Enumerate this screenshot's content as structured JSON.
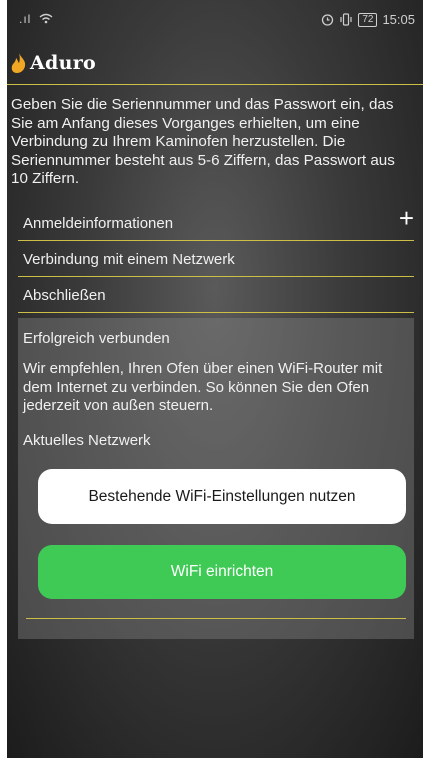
{
  "status_bar": {
    "signal": ".ıl",
    "wifi": "wifi-icon",
    "alarm": "alarm-icon",
    "vibrate": "vibrate-icon",
    "battery": "72",
    "time": "15:05"
  },
  "app": {
    "brand": "Aduro",
    "accent_color": "#cbbf47",
    "logo_color": "#f0a824"
  },
  "intro_text": "Geben Sie die Seriennummer und das Passwort ein, das Sie am Anfang dieses Vorganges erhielten, um eine Verbindung zu Ihrem Kaminofen herzustellen. Die Seriennummer besteht aus 5-6 Ziffern, das Passwort aus 10 Ziffern.",
  "steps": [
    {
      "label": "Anmeldeinformationen",
      "icon": "plus-icon",
      "icon_text": "+"
    },
    {
      "label": "Verbindung mit einem Netzwerk"
    },
    {
      "label": "Abschließen"
    }
  ],
  "panel": {
    "title": "Erfolgreich verbunden",
    "text": "Wir empfehlen, Ihren Ofen über einen WiFi-Router mit dem Internet zu verbinden. So können Sie den Ofen jederzeit von außen steuern.",
    "subtitle": "Aktuelles Netzwerk",
    "button_existing": "Bestehende WiFi-Einstellungen nutzen",
    "button_setup": "WiFi einrichten",
    "button_setup_color": "#3fc955"
  }
}
